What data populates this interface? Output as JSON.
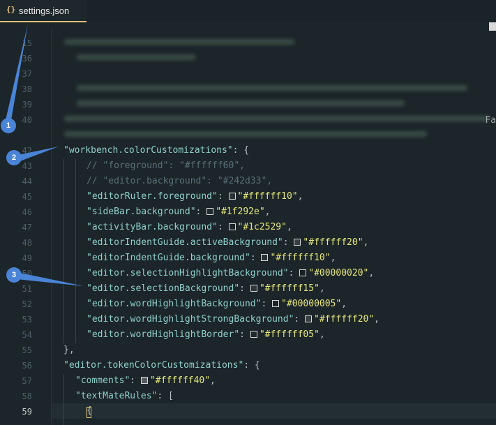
{
  "tab": {
    "icon": "{}",
    "label": "settings.json"
  },
  "edge_glyph": "Fa",
  "gutter": {
    "blurred": [
      "15",
      "36",
      "37",
      "38",
      "39",
      "40"
    ],
    "visible": [
      "42",
      "43",
      "44",
      "45",
      "46",
      "47",
      "48",
      "49",
      "50",
      "51",
      "52",
      "53",
      "54",
      "55",
      "56",
      "57",
      "58",
      "59"
    ],
    "active_line": "59"
  },
  "code": {
    "l42": {
      "key": "\"workbench.colorCustomizations\"",
      "punct": ": {"
    },
    "l43": {
      "comment": "// \"foreground\": \"#ffffff60\","
    },
    "l44": {
      "comment": "// \"editor.background\": \"#242d33\","
    },
    "l45": {
      "key": "\"editorRuler.foreground\"",
      "punct": ": ",
      "value": "\"#ffffff10\"",
      "end": ","
    },
    "l46": {
      "key": "\"sideBar.background\"",
      "punct": ": ",
      "value": "\"#1f292e\"",
      "end": ","
    },
    "l47": {
      "key": "\"activityBar.background\"",
      "punct": ": ",
      "value": "\"#1c2529\"",
      "end": ","
    },
    "l48": {
      "key": "\"editorIndentGuide.activeBackground\"",
      "punct": ": ",
      "value": "\"#ffffff20\"",
      "end": ","
    },
    "l49": {
      "key": "\"editorIndentGuide.background\"",
      "punct": ": ",
      "value": "\"#ffffff10\"",
      "end": ","
    },
    "l50": {
      "key": "\"editor.selectionHighlightBackground\"",
      "punct": ": ",
      "value": "\"#00000020\"",
      "end": ","
    },
    "l51": {
      "key": "\"editor.selectionBackground\"",
      "punct": ": ",
      "value": "\"#ffffff15\"",
      "end": ","
    },
    "l52": {
      "key": "\"editor.wordHighlightBackground\"",
      "punct": ": ",
      "value": "\"#00000005\"",
      "end": ","
    },
    "l53": {
      "key": "\"editor.wordHighlightStrongBackground\"",
      "punct": ": ",
      "value": "\"#ffffff20\"",
      "end": ","
    },
    "l54": {
      "key": "\"editor.wordHighlightBorder\"",
      "punct": ": ",
      "value": "\"#ffffff05\"",
      "end": ","
    },
    "l55": {
      "punct": "},"
    },
    "l56": {
      "key": "\"editor.tokenColorCustomizations\"",
      "punct": ": {"
    },
    "l57": {
      "key": "\"comments\"",
      "punct": ": ",
      "value": "\"#ffffff40\"",
      "end": ","
    },
    "l58": {
      "key": "\"textMateRules\"",
      "punct": ": ["
    },
    "l59": {
      "punct": "{"
    }
  },
  "swatches": {
    "l45": "#ffffff10",
    "l46": "#1f292e",
    "l47": "#1c2529",
    "l48": "#ffffff20",
    "l49": "#ffffff10",
    "l50": "#00000020",
    "l51": "#ffffff15",
    "l52": "#00000005",
    "l53": "#ffffff20",
    "l54": "#ffffff05",
    "l57": "#ffffff40"
  },
  "callouts": [
    "1",
    "2",
    "3"
  ]
}
